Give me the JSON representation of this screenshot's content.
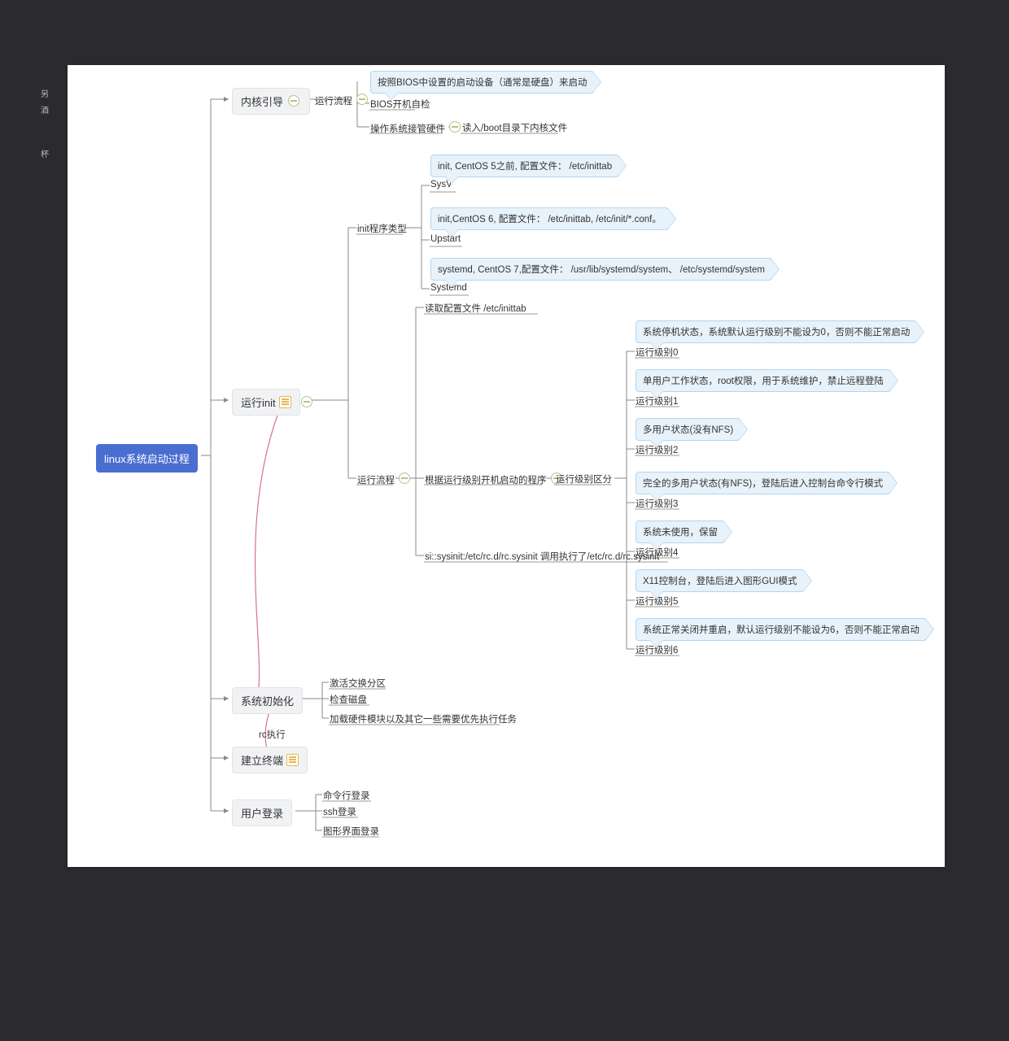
{
  "sidebar": {
    "a": "另",
    "b": "酒",
    "c": "杯"
  },
  "root": "linux系统启动过程",
  "branch": {
    "kernel": "内核引导",
    "init": "运行init",
    "sysinit": "系统初始化",
    "terminal": "建立终端",
    "login": "用户登录"
  },
  "kernel": {
    "flow": "运行流程",
    "bios": "BIOS开机自检",
    "hw": "操作系统接管硬件",
    "boot": "读入/boot目录下内核文件",
    "bubble": "按照BIOS中设置的启动设备（通常是硬盘）来启动"
  },
  "init": {
    "types": "init程序类型",
    "sysv": "SysV",
    "upstart": "Upstart",
    "systemd": "Systemd",
    "b_sysv": "init, CentOS 5之前, 配置文件： /etc/inittab",
    "b_upstart": "init,CentOS 6, 配置文件： /etc/inittab, /etc/init/*.conf。",
    "b_systemd": "systemd, CentOS 7,配置文件： /usr/lib/systemd/system、 /etc/systemd/system",
    "flow": "运行流程",
    "readcfg": "读取配置文件 /etc/inittab",
    "byrl": "根据运行级别开机启动的程序",
    "rldiff": "运行级别区分",
    "sysinit_line": "si::sysinit:/etc/rc.d/rc.sysinit    调用执行了/etc/rc.d/rc.sysinit"
  },
  "rl": {
    "l0": "运行级别0",
    "l1": "运行级别1",
    "l2": "运行级别2",
    "l3": "运行级别3",
    "l4": "运行级别4",
    "l5": "运行级别5",
    "l6": "运行级别6",
    "b0": "系统停机状态，系统默认运行级别不能设为0，否则不能正常启动",
    "b1": "单用户工作状态，root权限，用于系统维护，禁止远程登陆",
    "b2": "多用户状态(没有NFS)",
    "b3": "完全的多用户状态(有NFS)，登陆后进入控制台命令行模式",
    "b4": "系统未使用，保留",
    "b5": "X11控制台，登陆后进入图形GUI模式",
    "b6": "系统正常关闭并重启，默认运行级别不能设为6，否则不能正常启动"
  },
  "sysinit": {
    "a": "激活交换分区",
    "b": "检查磁盘",
    "c": "加载硬件模块以及其它一些需要优先执行任务",
    "rc": "rc执行"
  },
  "login": {
    "a": "命令行登录",
    "b": "ssh登录",
    "c": "图形界面登录"
  }
}
